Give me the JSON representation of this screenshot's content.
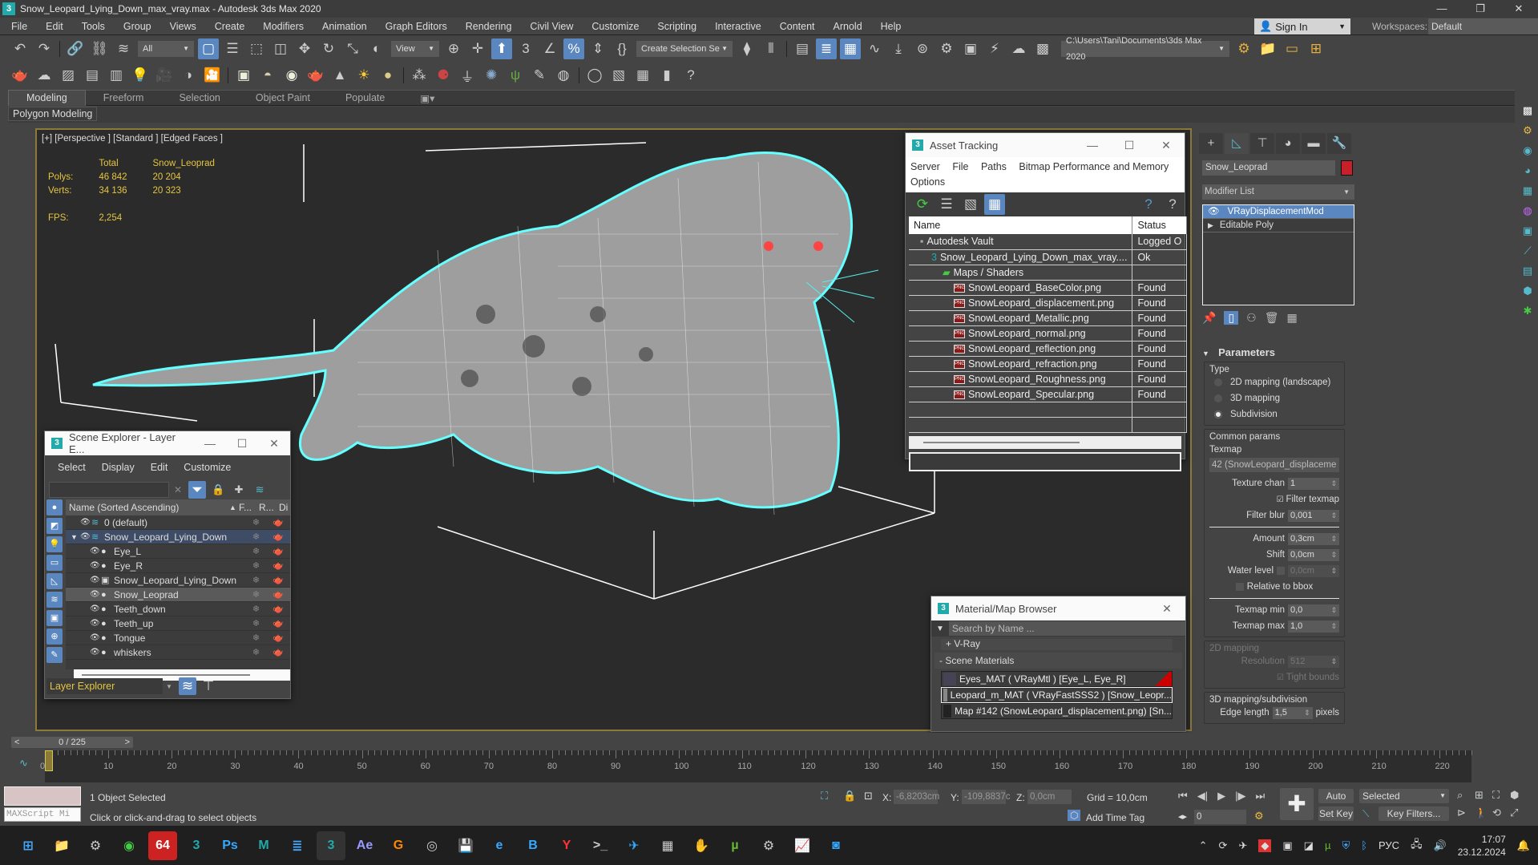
{
  "window": {
    "title": "Snow_Leopard_Lying_Down_max_vray.max - Autodesk 3ds Max 2020",
    "app_icon": "3",
    "controls": [
      "minimize",
      "maximize",
      "close"
    ]
  },
  "menu": [
    "File",
    "Edit",
    "Tools",
    "Group",
    "Views",
    "Create",
    "Modifiers",
    "Animation",
    "Graph Editors",
    "Rendering",
    "Civil View",
    "Customize",
    "Scripting",
    "Interactive",
    "Content",
    "Arnold",
    "Help"
  ],
  "account": {
    "sign_in": "Sign In",
    "workspaces_label": "Workspaces:",
    "workspace": "Default"
  },
  "toolbar": {
    "selection_filter": "All",
    "ref_coord": "View",
    "named_selection": "Create Selection Se",
    "project_path": "C:\\Users\\Tani\\Documents\\3ds Max 2020"
  },
  "ribbon": {
    "tabs": [
      "Modeling",
      "Freeform",
      "Selection",
      "Object Paint",
      "Populate"
    ],
    "active_tab": "Modeling",
    "sub_label": "Polygon Modeling"
  },
  "viewport": {
    "label": "[+] [Perspective ] [Standard ] [Edged Faces ]",
    "stats": {
      "col_total": "Total",
      "col_object": "Snow_Leoprad",
      "polys_label": "Polys:",
      "polys_total": "46 842",
      "polys_object": "20 204",
      "verts_label": "Verts:",
      "verts_total": "34 136",
      "verts_object": "20 323",
      "fps_label": "FPS:",
      "fps": "2,254"
    },
    "accent_color": "#8d7a3a",
    "stats_color": "#e5c53f"
  },
  "asset_tracking": {
    "title": "Asset Tracking",
    "menu": [
      "Server",
      "File",
      "Paths",
      "Bitmap Performance and Memory",
      "Options"
    ],
    "columns": [
      "Name",
      "Status"
    ],
    "rows": [
      {
        "name": "Autodesk Vault",
        "status": "Logged O",
        "indent": 1,
        "icon": "vault-icon"
      },
      {
        "name": "Snow_Leopard_Lying_Down_max_vray....",
        "status": "Ok",
        "indent": 2,
        "icon": "max-file-icon"
      },
      {
        "name": "Maps / Shaders",
        "status": "",
        "indent": 3,
        "icon": "maps-icon"
      },
      {
        "name": "SnowLeopard_BaseColor.png",
        "status": "Found",
        "indent": 4,
        "icon": "png-icon"
      },
      {
        "name": "SnowLeopard_displacement.png",
        "status": "Found",
        "indent": 4,
        "icon": "png-icon"
      },
      {
        "name": "SnowLeopard_Metallic.png",
        "status": "Found",
        "indent": 4,
        "icon": "png-icon"
      },
      {
        "name": "SnowLeopard_normal.png",
        "status": "Found",
        "indent": 4,
        "icon": "png-icon"
      },
      {
        "name": "SnowLeopard_reflection.png",
        "status": "Found",
        "indent": 4,
        "icon": "png-icon"
      },
      {
        "name": "SnowLeopard_refraction.png",
        "status": "Found",
        "indent": 4,
        "icon": "png-icon"
      },
      {
        "name": "SnowLeopard_Roughness.png",
        "status": "Found",
        "indent": 4,
        "icon": "png-icon"
      },
      {
        "name": "SnowLeopard_Specular.png",
        "status": "Found",
        "indent": 4,
        "icon": "png-icon"
      }
    ]
  },
  "scene_explorer": {
    "title": "Scene Explorer - Layer E...",
    "menu": [
      "Select",
      "Display",
      "Edit",
      "Customize"
    ],
    "columns": [
      "Name (Sorted Ascending)",
      "F...",
      "R...",
      "Di"
    ],
    "rows": [
      {
        "name": "0 (default)",
        "type": "layer",
        "level": 0,
        "state": "normal"
      },
      {
        "name": "Snow_Leopard_Lying_Down",
        "type": "layer",
        "level": 0,
        "state": "layer-selected"
      },
      {
        "name": "Eye_L",
        "type": "object",
        "level": 1,
        "state": "normal"
      },
      {
        "name": "Eye_R",
        "type": "object",
        "level": 1,
        "state": "normal"
      },
      {
        "name": "Snow_Leopard_Lying_Down",
        "type": "group",
        "level": 1,
        "state": "normal"
      },
      {
        "name": "Snow_Leoprad",
        "type": "object",
        "level": 1,
        "state": "selected"
      },
      {
        "name": "Teeth_down",
        "type": "object",
        "level": 1,
        "state": "normal"
      },
      {
        "name": "Teeth_up",
        "type": "object",
        "level": 1,
        "state": "normal"
      },
      {
        "name": "Tongue",
        "type": "object",
        "level": 1,
        "state": "normal"
      },
      {
        "name": "whiskers",
        "type": "object",
        "level": 1,
        "state": "normal"
      }
    ],
    "explorer_type": "Layer Explorer"
  },
  "command_panel": {
    "object_name": "Snow_Leoprad",
    "object_color": "#c8202b",
    "modifier_list": "Modifier List",
    "stack": [
      "VRayDisplacementMod",
      "Editable Poly"
    ],
    "selected_modifier": "VRayDisplacementMod",
    "parameters": {
      "title": "Parameters",
      "type_label": "Type",
      "types": [
        "2D mapping (landscape)",
        "3D mapping",
        "Subdivision"
      ],
      "selected_type": "Subdivision",
      "common_params": "Common params",
      "texmap_label": "Texmap",
      "texmap_value": "42 (SnowLeopard_displaceme",
      "texture_chan_label": "Texture chan",
      "texture_chan": "1",
      "filter_texmap_label": "Filter texmap",
      "filter_texmap": true,
      "filter_blur_label": "Filter blur",
      "filter_blur": "0,001",
      "amount_label": "Amount",
      "amount": "0,3cm",
      "shift_label": "Shift",
      "shift": "0,0cm",
      "water_level_label": "Water level",
      "water_level": "0,0cm",
      "relative_bbox_label": "Relative to bbox",
      "texmap_min_label": "Texmap min",
      "texmap_min": "0,0",
      "texmap_max_label": "Texmap max",
      "texmap_max": "1,0",
      "mapping2d_label": "2D mapping",
      "resolution_label": "Resolution",
      "resolution": "512",
      "tight_bounds_label": "Tight bounds",
      "mapping3d_label": "3D mapping/subdivision",
      "edge_length_label": "Edge length",
      "edge_length": "1,5",
      "edge_length_unit": "pixels"
    }
  },
  "material_browser": {
    "title": "Material/Map Browser",
    "search_placeholder": "Search by Name ...",
    "vray_group": "+ V-Ray",
    "scene_materials": "- Scene Materials",
    "items": [
      "Eyes_MAT  ( VRayMtl )  [Eye_L, Eye_R]",
      "Leopard_m_MAT  ( VRayFastSSS2 )  [Snow_Leopr...",
      "Map #142 (SnowLeopard_displacement.png)  [Sn..."
    ]
  },
  "timeline": {
    "frame_display": "0 / 225",
    "current_frame": 0,
    "total_frames": 225,
    "tick_labels": [
      "0",
      "10",
      "20",
      "30",
      "40",
      "50",
      "60",
      "70",
      "80",
      "90",
      "100",
      "110",
      "120",
      "130",
      "140",
      "150",
      "160",
      "170",
      "180",
      "190",
      "200",
      "210",
      "220"
    ]
  },
  "status": {
    "maxscript_label": "MAXScript Mi",
    "selection": "1 Object Selected",
    "prompt": "Click or click-and-drag to select objects",
    "x_label": "X:",
    "x": "-6,8203cm",
    "y_label": "Y:",
    "y": "-109,8837c",
    "z_label": "Z:",
    "z": "0,0cm",
    "grid": "Grid = 10,0cm",
    "add_time_tag": "Add Time Tag",
    "frame_spinner": "0",
    "auto_key": "Auto Key",
    "set_key": "Set Key",
    "key_mode": "Selected",
    "key_filters": "Key Filters..."
  },
  "taskbar": {
    "apps": [
      "start",
      "file-explorer",
      "ti-settings",
      "chrome",
      "aida64",
      "3ds-max",
      "photoshop",
      "maya",
      "notepad",
      "3ds-max-active",
      "after-effects",
      "g-app",
      "hp-app",
      "save-app",
      "edge",
      "b-app",
      "yandex",
      "terminal",
      "telegram",
      "calculator",
      "hand-app",
      "utorrent",
      "settings",
      "monitor",
      "camera"
    ],
    "active_app": "3ds-max-active",
    "tray_language": "РУС",
    "time": "17:07",
    "date": "23.12.2024"
  }
}
